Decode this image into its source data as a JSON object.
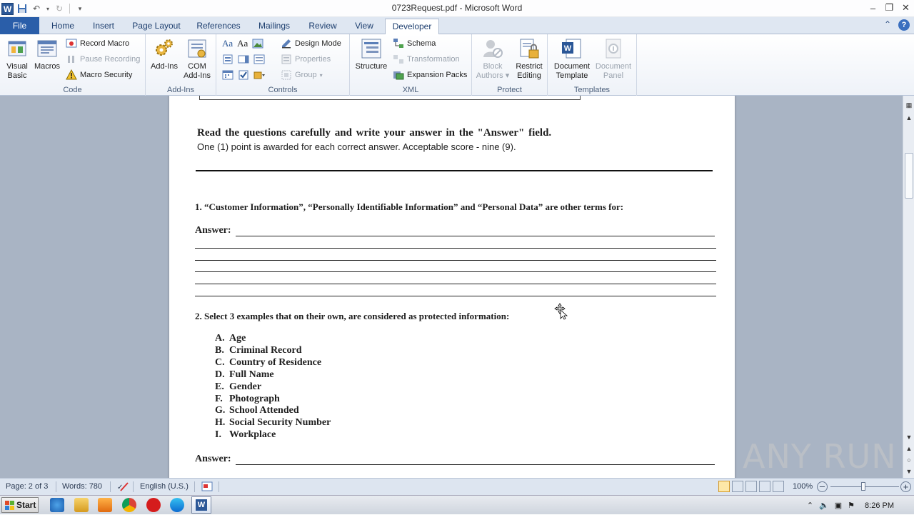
{
  "window": {
    "title": "0723Request.pdf - Microsoft Word",
    "app_logo_letter": "W",
    "controls": [
      "minimize-icon",
      "restore-icon",
      "close-icon"
    ]
  },
  "tabs": {
    "file": "File",
    "items": [
      "Home",
      "Insert",
      "Page Layout",
      "References",
      "Mailings",
      "Review",
      "View",
      "Developer"
    ],
    "active": "Developer"
  },
  "ribbon": {
    "code": {
      "label": "Code",
      "visual_basic": "Visual Basic",
      "macros": "Macros",
      "record_macro": "Record Macro",
      "pause_recording": "Pause Recording",
      "macro_security": "Macro Security"
    },
    "addins": {
      "label": "Add-Ins",
      "add_ins": "Add-Ins",
      "com_add_ins": "COM Add-Ins"
    },
    "controls": {
      "label": "Controls",
      "design_mode": "Design Mode",
      "properties": "Properties",
      "group": "Group"
    },
    "xml": {
      "label": "XML",
      "structure": "Structure",
      "schema": "Schema",
      "transformation": "Transformation",
      "expansion_packs": "Expansion Packs"
    },
    "protect": {
      "label": "Protect",
      "block_authors": "Block Authors",
      "restrict_editing": "Restrict Editing"
    },
    "templates": {
      "label": "Templates",
      "document_template": "Document Template",
      "document_panel": "Document Panel"
    }
  },
  "document": {
    "instructions_bold": "Read the questions carefully and write your answer in the \"Answer\" field.",
    "instructions_regular": "One (1) point is awarded for each correct answer. Acceptable score - nine (9).",
    "q1": "1. “Customer Information”, “Personally Identifiable Information” and “Personal Data” are other terms for:",
    "answer_label": "Answer:",
    "q2": "2. Select 3 examples that on their own, are considered as protected information:",
    "options": [
      {
        "letter": "A.",
        "text": "Age"
      },
      {
        "letter": "B.",
        "text": "Criminal Record"
      },
      {
        "letter": "C.",
        "text": "Country of Residence"
      },
      {
        "letter": "D.",
        "text": "Full Name"
      },
      {
        "letter": "E.",
        "text": "Gender"
      },
      {
        "letter": "F.",
        "text": "Photograph"
      },
      {
        "letter": "G.",
        "text": "School Attended"
      },
      {
        "letter": "H.",
        "text": "Social Security Number"
      },
      {
        "letter": "I.",
        "text": "Workplace"
      }
    ]
  },
  "statusbar": {
    "page": "Page: 2 of 3",
    "words": "Words: 780",
    "language": "English (U.S.)",
    "zoom": "100%"
  },
  "taskbar": {
    "start": "Start",
    "time": "8:26 PM"
  },
  "watermark": "ANY RUN"
}
